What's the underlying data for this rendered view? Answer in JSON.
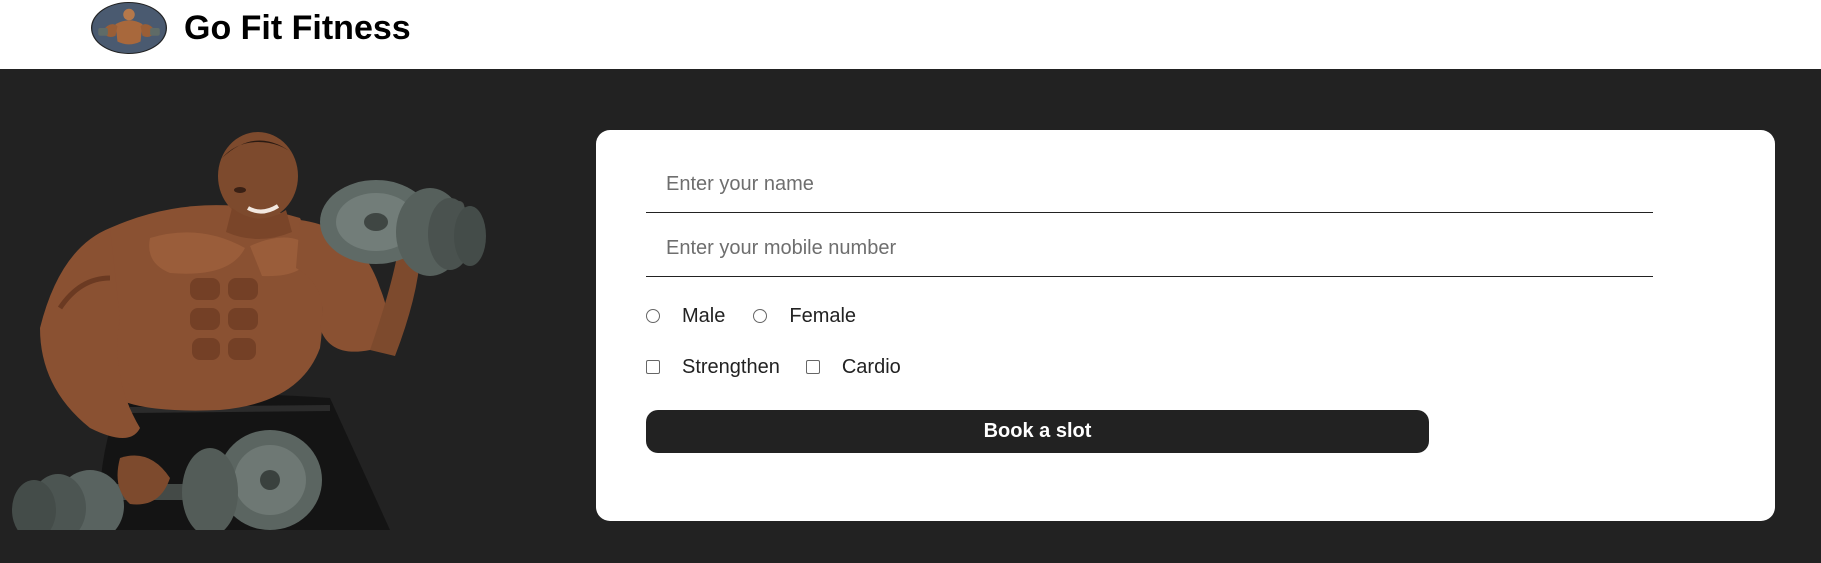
{
  "header": {
    "brand": "Go Fit Fitness",
    "logo_icon": "bodybuilder-logo-icon"
  },
  "hero": {
    "image_icon": "bodybuilder-with-dumbbells-image"
  },
  "form": {
    "name_placeholder": "Enter your name",
    "name_value": "",
    "mobile_placeholder": "Enter your mobile number",
    "mobile_value": "",
    "gender_options": [
      "Male",
      "Female"
    ],
    "goal_options": [
      "Strengthen",
      "Cardio"
    ],
    "submit_label": "Book a slot"
  },
  "colors": {
    "page_background": "#222222",
    "header_background": "#ffffff",
    "card_background": "#ffffff",
    "button_background": "#222222",
    "button_text": "#ffffff"
  }
}
